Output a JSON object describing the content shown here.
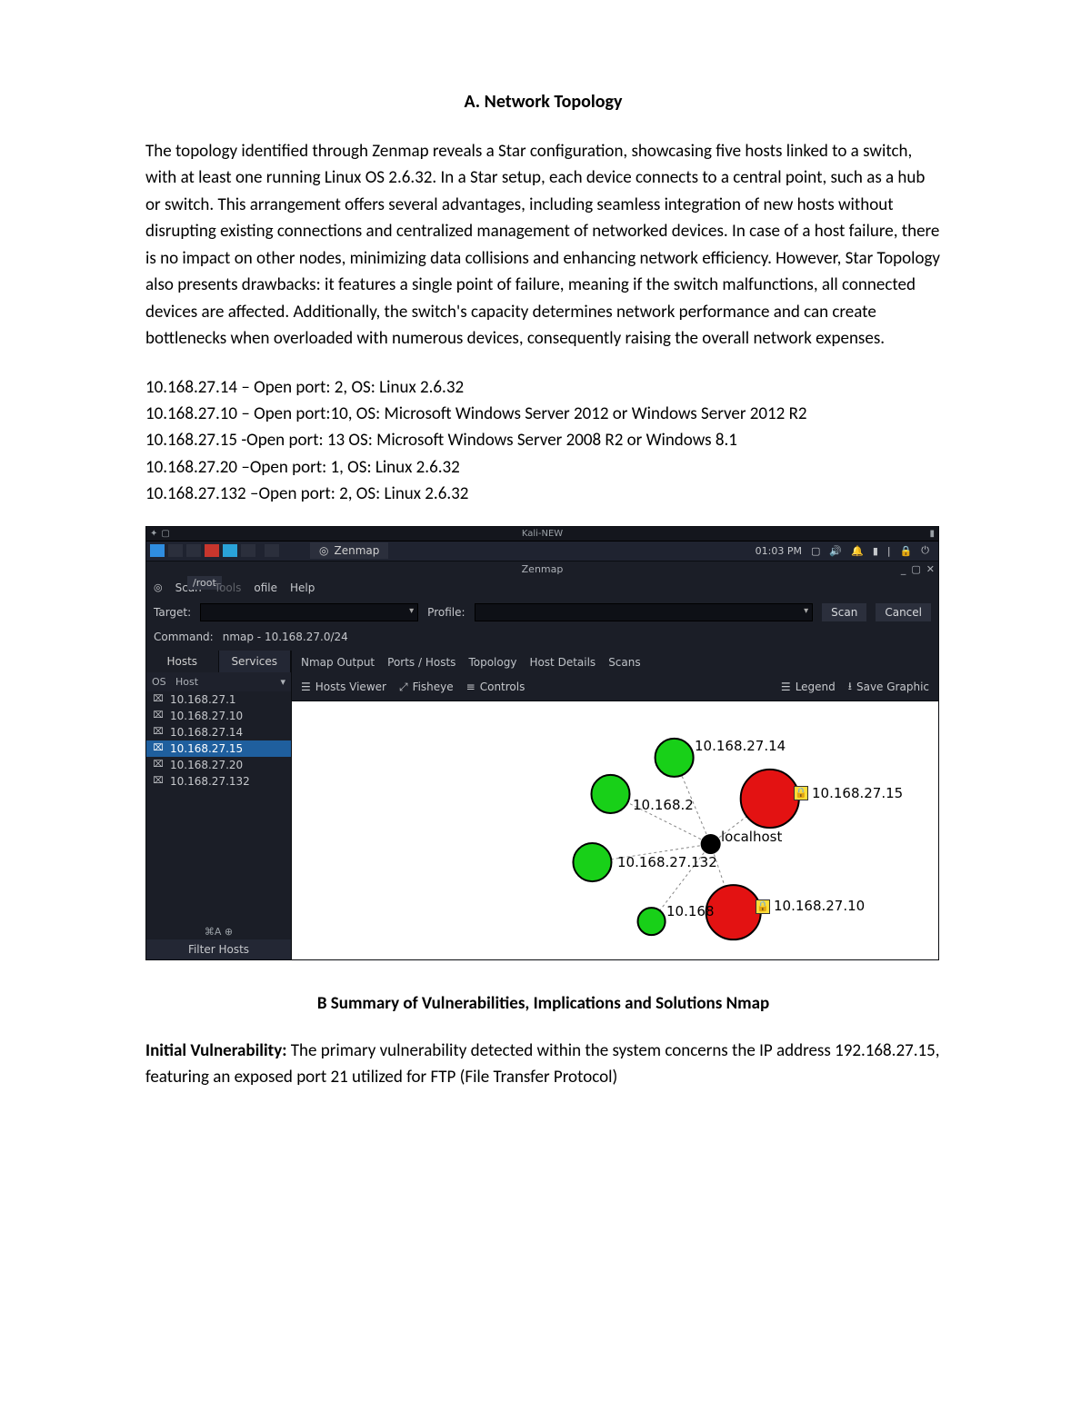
{
  "doc": {
    "heading_a": "A.   Network Topology",
    "para1": "The topology identified through Zenmap reveals a Star configuration, showcasing five hosts linked to a switch, with at least one running Linux OS 2.6.32. In a Star setup, each device connects to a central point, such as a hub or switch. This arrangement offers several advantages, including seamless integration of new hosts without disrupting existing connections and centralized management of networked devices. In case of a host failure, there is no impact on other nodes, minimizing data collisions and enhancing network efficiency. However, Star Topology also presents drawbacks: it features a single point of failure, meaning if the switch malfunctions, all connected devices are affected. Additionally, the switch's capacity determines network performance and can create bottlenecks when overloaded with numerous devices, consequently raising the overall network expenses.",
    "hosts": [
      "10.168.27.14 – Open port: 2, OS: Linux 2.6.32",
      "10.168.27.10 – Open port:10, OS: Microsoft Windows Server 2012 or Windows Server 2012 R2",
      "10.168.27.15 -Open port: 13 OS: Microsoft Windows Server 2008 R2 or Windows 8.1",
      "10.168.27.20 –Open port: 1, OS: Linux 2.6.32",
      "10.168.27.132 –Open port: 2, OS: Linux 2.6.32"
    ],
    "heading_b": "B Summary of Vulnerabilities, Implications and Solutions Nmap",
    "para2_lead": "Initial Vulnerability:",
    "para2_rest": " The primary vulnerability detected within the system concerns the IP address 192.168.27.15, featuring an exposed port 21 utilized for FTP (File Transfer Protocol)"
  },
  "zenmap": {
    "os_title": "Kali-NEW",
    "taskbar_tab": "Zenmap",
    "clock": "01:03 PM",
    "window_title": "Zenmap",
    "menu": {
      "scan": "Scan",
      "tools": "Tools",
      "profile": "ofile",
      "help": "Help",
      "crumb": "/root"
    },
    "target_label": "Target:",
    "profile_label": "Profile:",
    "scan_btn": "Scan",
    "cancel_btn": "Cancel",
    "command_label": "Command:",
    "command_value": "nmap - 10.168.27.0/24",
    "side_tabs": {
      "hosts": "Hosts",
      "services": "Services"
    },
    "host_header_os": "OS",
    "host_header_host": "Host",
    "host_items": [
      "10.168.27.1",
      "10.168.27.10",
      "10.168.27.14",
      "10.168.27.15",
      "10.168.27.20",
      "10.168.27.132"
    ],
    "selected_host_index": 3,
    "side_bottom": "⌘A  ⊕",
    "filter_hosts": "Filter Hosts",
    "detail_tabs": [
      "Nmap Output",
      "Ports / Hosts",
      "Topology",
      "Host Details",
      "Scans"
    ],
    "tool_row": {
      "hosts_viewer": "Hosts Viewer",
      "fisheye": "Fisheye",
      "controls": "Controls",
      "legend": "Legend",
      "save": "Save Graphic"
    },
    "topology_labels": {
      "n1": "10.168.27.14",
      "n2": "10.168.2",
      "n3": "10.168.27.15",
      "center": "localhost",
      "n4": "10.168.27.132",
      "n5": "10.168",
      "n6": "10.168.27.10"
    }
  }
}
